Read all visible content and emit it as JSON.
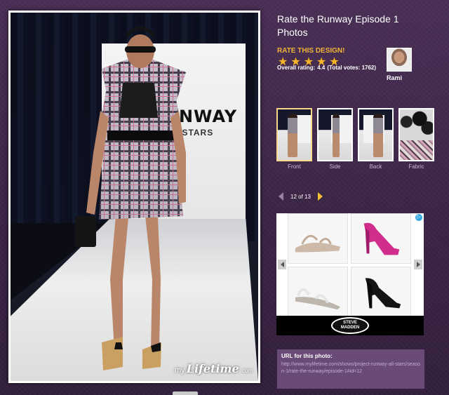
{
  "page": {
    "title": "Rate the Runway Episode 1 Photos"
  },
  "rating": {
    "label": "RATE THIS DESIGN!",
    "stars": 5,
    "star_glyph": "★",
    "overall_label": "Overall rating:",
    "overall_value": "4.4",
    "votes_text": "(Total votes: 1762)"
  },
  "judge": {
    "name": "Rami"
  },
  "thumbnails": [
    {
      "label": "Front",
      "selected": true
    },
    {
      "label": "Side",
      "selected": false
    },
    {
      "label": "Back",
      "selected": false
    },
    {
      "label": "Fabric",
      "selected": false
    }
  ],
  "pager": {
    "text": "12 of 13"
  },
  "photo": {
    "backdrop_text_1": "RUNWAY",
    "backdrop_text_2": "ALL STARS",
    "watermark_my": "my",
    "watermark_brand": "Lifetime",
    "watermark_com": ".com"
  },
  "ad": {
    "brand_line_1": "STEVE",
    "brand_line_2": "MADDEN",
    "choice_icon": "▷"
  },
  "url_box": {
    "label": "URL for this photo:",
    "url": "http://www.mylifetime.com/shows/project-runway-all-stars/season-1/rate-the-runway/episode-1#id=12"
  },
  "colors": {
    "accent": "#f0b43a",
    "star": "#f5b52b",
    "background": "#3d2648"
  }
}
